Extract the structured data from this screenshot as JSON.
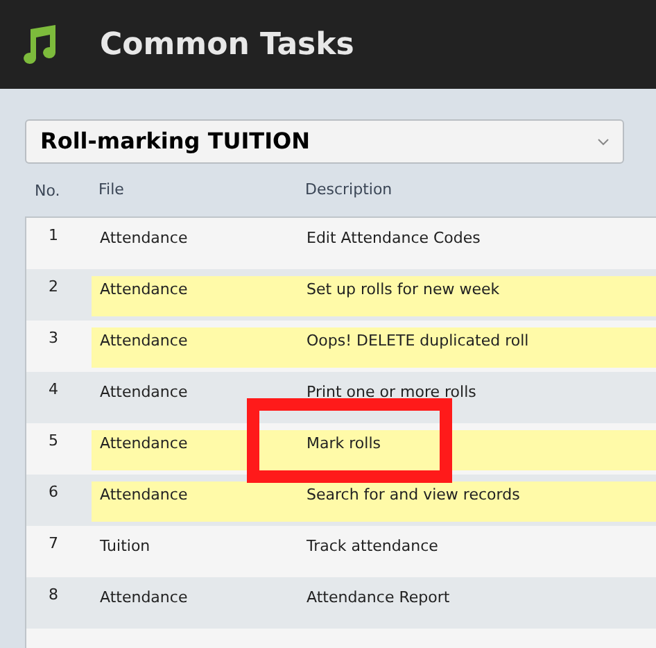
{
  "header": {
    "title": "Common Tasks"
  },
  "select": {
    "value": "Roll-marking TUITION"
  },
  "table": {
    "columns": [
      "No.",
      "File",
      "Description"
    ],
    "rows": [
      {
        "no": "1",
        "file": "Attendance",
        "description": "Edit Attendance Codes",
        "highlighted": false,
        "annotated": false
      },
      {
        "no": "2",
        "file": "Attendance",
        "description": "Set up rolls for new week",
        "highlighted": true,
        "annotated": false
      },
      {
        "no": "3",
        "file": "Attendance",
        "description": "Oops! DELETE duplicated roll",
        "highlighted": true,
        "annotated": false
      },
      {
        "no": "4",
        "file": "Attendance",
        "description": "Print one or more rolls",
        "highlighted": false,
        "annotated": false
      },
      {
        "no": "5",
        "file": "Attendance",
        "description": "Mark rolls",
        "highlighted": true,
        "annotated": true
      },
      {
        "no": "6",
        "file": "Attendance",
        "description": "Search for and view records",
        "highlighted": true,
        "annotated": false
      },
      {
        "no": "7",
        "file": "Tuition",
        "description": "Track attendance",
        "highlighted": false,
        "annotated": false
      },
      {
        "no": "8",
        "file": "Attendance",
        "description": "Attendance Report",
        "highlighted": false,
        "annotated": false
      }
    ]
  }
}
